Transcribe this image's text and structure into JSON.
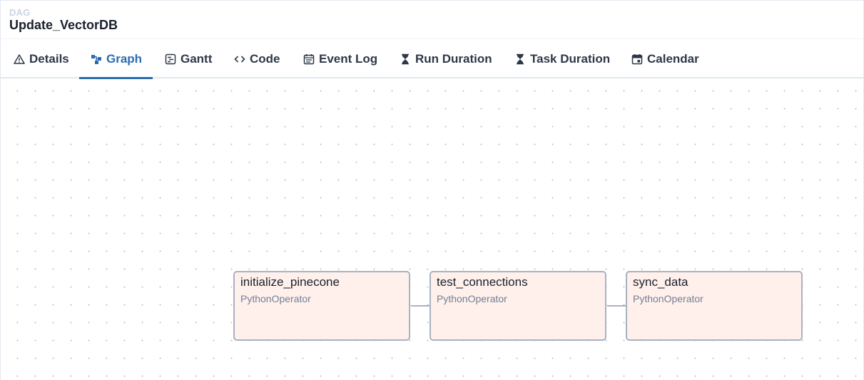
{
  "dag": {
    "kicker": "DAG",
    "title": "Update_VectorDB"
  },
  "tabs": [
    {
      "label": "Details",
      "icon": "warning-triangle-icon",
      "active": false
    },
    {
      "label": "Graph",
      "icon": "graph-icon",
      "active": true
    },
    {
      "label": "Gantt",
      "icon": "gantt-icon",
      "active": false
    },
    {
      "label": "Code",
      "icon": "code-icon",
      "active": false
    },
    {
      "label": "Event Log",
      "icon": "calendar-list-icon",
      "active": false
    },
    {
      "label": "Run Duration",
      "icon": "hourglass-icon",
      "active": false
    },
    {
      "label": "Task Duration",
      "icon": "hourglass-icon",
      "active": false
    },
    {
      "label": "Calendar",
      "icon": "calendar-icon",
      "active": false
    }
  ],
  "colors": {
    "accent": "#2b6cb0",
    "node_fill": "#fff0ec",
    "node_border": "#a9b2c1"
  },
  "graph": {
    "nodes": [
      {
        "id": "initialize_pinecone",
        "operator": "PythonOperator"
      },
      {
        "id": "test_connections",
        "operator": "PythonOperator"
      },
      {
        "id": "sync_data",
        "operator": "PythonOperator"
      }
    ],
    "edges": [
      {
        "from": "initialize_pinecone",
        "to": "test_connections"
      },
      {
        "from": "test_connections",
        "to": "sync_data"
      }
    ]
  }
}
